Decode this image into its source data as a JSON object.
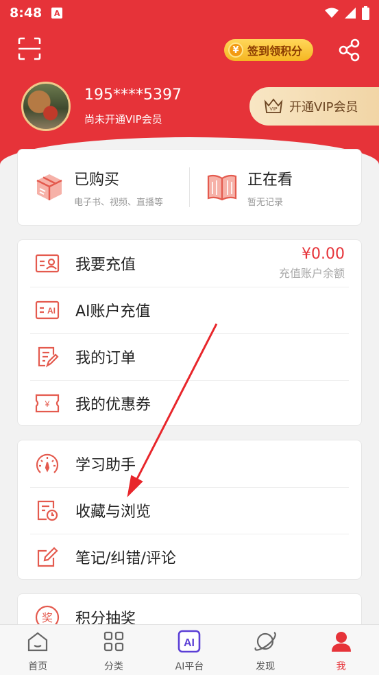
{
  "status_bar": {
    "time": "8:48",
    "notification_badge": "A"
  },
  "header": {
    "checkin_coin": "¥",
    "checkin_label": "签到领积分",
    "username": "195****5397",
    "vip_status": "尚未开通VIP会员",
    "vip_button_label": "开通VIP会员",
    "vip_badge": "VIP"
  },
  "top_card": {
    "purchased": {
      "title": "已购买",
      "subtitle": "电子书、视频、直播等"
    },
    "watching": {
      "title": "正在看",
      "subtitle": "暂无记录"
    }
  },
  "wallet": {
    "recharge_label": "我要充值",
    "balance_amount": "¥0.00",
    "balance_label": "充值账户余额",
    "ai_recharge_label": "AI账户充值",
    "ai_icon_text": "AI",
    "orders_label": "我的订单",
    "coupons_label": "我的优惠券",
    "coupon_icon_text": "¥"
  },
  "tools": {
    "assistant_label": "学习助手",
    "favorites_label": "收藏与浏览",
    "notes_label": "笔记/纠错/评论"
  },
  "lottery": {
    "label": "积分抽奖",
    "icon_text": "奖"
  },
  "tabbar": {
    "home": "首页",
    "category": "分类",
    "ai": "AI平台",
    "ai_icon_text": "AI",
    "discover": "发现",
    "me": "我"
  },
  "colors": {
    "accent": "#e63339",
    "gold": "#f5b622",
    "vip": "#f1d4a4"
  }
}
